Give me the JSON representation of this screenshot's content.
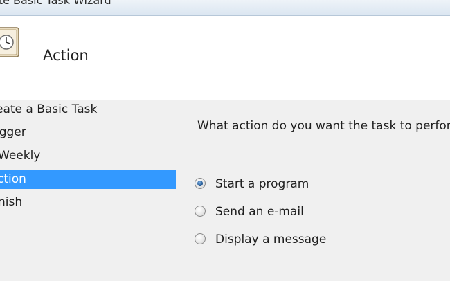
{
  "window": {
    "title": "ate Basic Task Wizard"
  },
  "header": {
    "title": "Action",
    "icon": "clock-icon"
  },
  "sidebar": {
    "steps": [
      {
        "label": "eate a Basic Task",
        "selected": false
      },
      {
        "label": "igger",
        "selected": false
      },
      {
        "label": "Weekly",
        "selected": false
      },
      {
        "label": "ction",
        "selected": true
      },
      {
        "label": "nish",
        "selected": false
      }
    ]
  },
  "main": {
    "question": "What action do you want the task to perfor",
    "options": [
      {
        "label": "Start a program",
        "checked": true
      },
      {
        "label": "Send an e-mail",
        "checked": false
      },
      {
        "label": "Display a message",
        "checked": false
      }
    ]
  },
  "colors": {
    "selection": "#3399ff",
    "header_bg": "#ffffff",
    "panel_bg": "#f0f0f0"
  }
}
